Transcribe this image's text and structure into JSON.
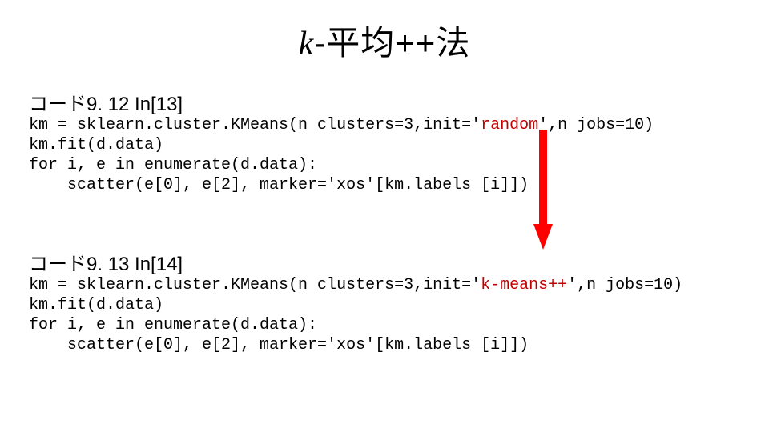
{
  "title": {
    "k": "k",
    "rest": "-平均++法"
  },
  "block1": {
    "heading": "コード9. 12 In[13]",
    "line1_pre": "km = sklearn.cluster.KMeans(n_clusters=3,init='",
    "line1_hl": "random",
    "line1_post": "',n_jobs=10)",
    "line2": "km.fit(d.data)",
    "line3": "for i, e in enumerate(d.data):",
    "line4": "    scatter(e[0], e[2], marker='xos'[km.labels_[i]])"
  },
  "block2": {
    "heading": "コード9. 13 In[14]",
    "line1_pre": "km = sklearn.cluster.KMeans(n_clusters=3,init='",
    "line1_hl": "k-means++",
    "line1_post": "',n_jobs=10)",
    "line2": "km.fit(d.data)",
    "line3": "for i, e in enumerate(d.data):",
    "line4": "    scatter(e[0], e[2], marker='xos'[km.labels_[i]])"
  },
  "arrow_color": "#ff0000"
}
